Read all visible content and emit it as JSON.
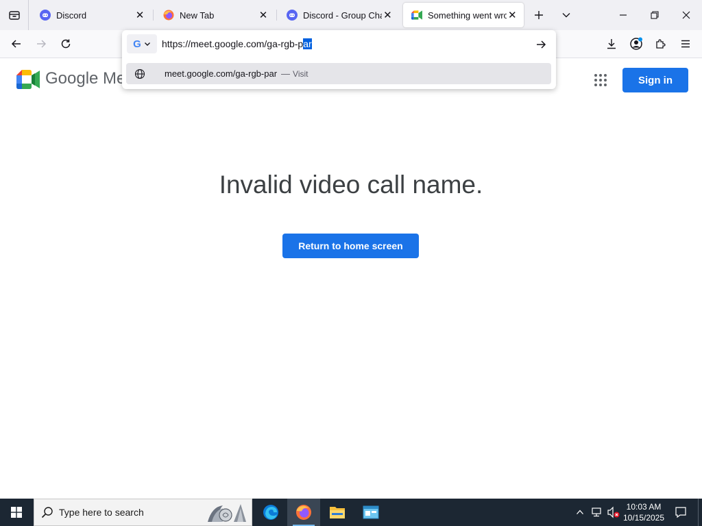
{
  "browser": {
    "tabs": [
      {
        "title": "Discord",
        "favicon": "discord-icon",
        "active": false
      },
      {
        "title": "New Tab",
        "favicon": "firefox-icon",
        "active": false
      },
      {
        "title": "Discord - Group Chat T",
        "favicon": "discord-icon",
        "active": false
      },
      {
        "title": "Something went wrong",
        "favicon": "google-meet-icon",
        "active": true
      }
    ],
    "url": {
      "value_unselected": "https://meet.google.com/ga-rgb-p",
      "value_selected": "ar"
    },
    "suggestion": {
      "url": "meet.google.com/ga-rgb-par",
      "separator": "—",
      "action": "Visit"
    },
    "search_engine": "G"
  },
  "page": {
    "brand_wordmark": "Google Me",
    "sign_in_label": "Sign in",
    "error_title": "Invalid video call name.",
    "home_button_label": "Return to home screen"
  },
  "taskbar": {
    "search_placeholder": "Type here to search",
    "clock_time": "10:03 AM",
    "clock_date": "10/15/2025"
  },
  "colors": {
    "google_blue": "#1a73e8",
    "taskbar_bg": "#1c2733",
    "discord": "#5865f2",
    "selection": "#0060df"
  }
}
